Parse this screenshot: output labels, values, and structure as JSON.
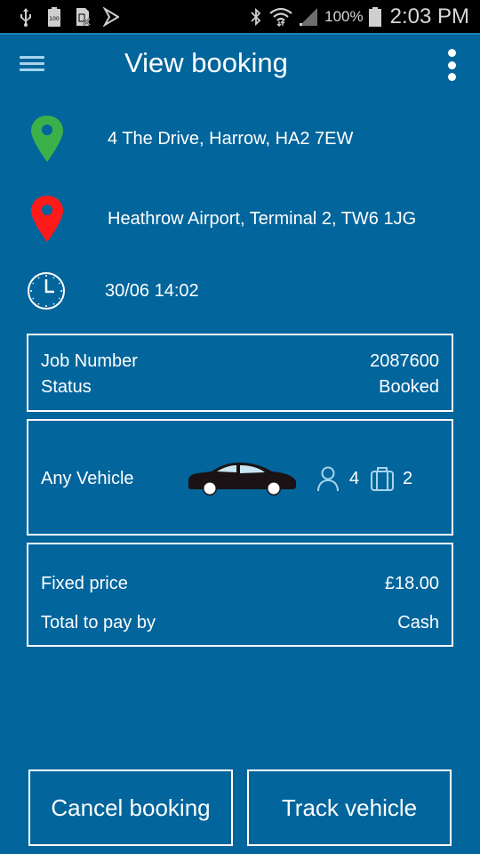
{
  "status_bar": {
    "left_icons": [
      "usb-icon",
      "battery-100-icon",
      "sim-card-missing-icon",
      "play-store-icon"
    ],
    "right_icons": [
      "bluetooth-icon",
      "wifi-icon",
      "signal-icon"
    ],
    "battery_percent": "100%",
    "time": "2:03 PM"
  },
  "app_bar": {
    "title": "View booking",
    "menu_icon": "hamburger-menu-icon",
    "overflow_icon": "more-vert-icon"
  },
  "journey": {
    "pickup": {
      "icon": "pin-green-icon",
      "address": "4 The Drive, Harrow, HA2 7EW",
      "color": "#3cb14a"
    },
    "dropoff": {
      "icon": "pin-red-icon",
      "address": "Heathrow Airport, Terminal 2, TW6 1JG",
      "color": "#ff1a1a"
    },
    "time": {
      "icon": "clock-icon",
      "value": "30/06 14:02"
    }
  },
  "job": {
    "job_number_label": "Job Number",
    "job_number_value": "2087600",
    "status_label": "Status",
    "status_value": "Booked"
  },
  "vehicle": {
    "name": "Any Vehicle",
    "passengers": "4",
    "luggage": "2"
  },
  "price": {
    "fixed_price_label": "Fixed price",
    "fixed_price_value": "£18.00",
    "pay_by_label": "Total to pay by",
    "pay_by_value": "Cash"
  },
  "actions": {
    "cancel_label": "Cancel booking",
    "track_label": "Track vehicle"
  },
  "colors": {
    "background": "#02659c",
    "text": "#ffffff",
    "icon_light": "#a8d4ee"
  }
}
